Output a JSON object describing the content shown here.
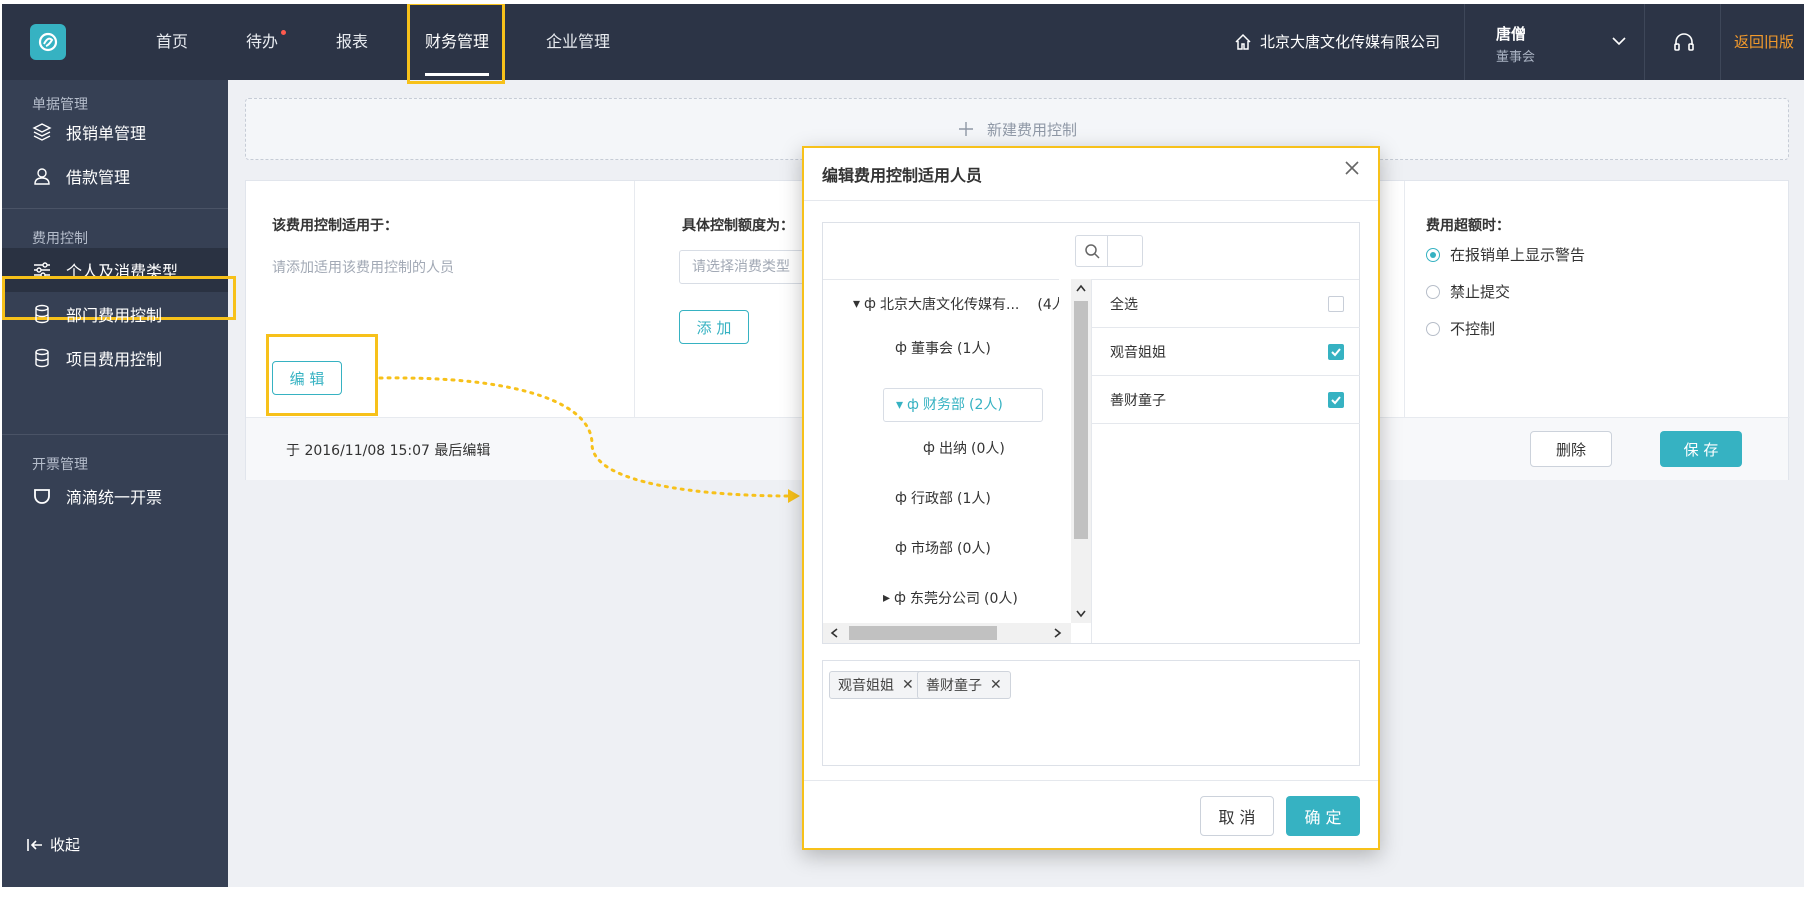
{
  "colors": {
    "accent": "#36b2c2",
    "highlight": "#f7c11a",
    "topbar": "#2c3446",
    "sidebar": "#364054",
    "legacy_link": "#f39a2b"
  },
  "topbar": {
    "nav": [
      {
        "label": "首页",
        "icon": ""
      },
      {
        "label": "待办",
        "badge_dot": true
      },
      {
        "label": "报表"
      },
      {
        "label": "财务管理",
        "active": true
      },
      {
        "label": "企业管理"
      }
    ],
    "company": "北京大唐文化传媒有限公司",
    "user_name": "唐僧",
    "user_role": "董事会",
    "back_old": "返回旧版"
  },
  "sidebar": {
    "groups": [
      {
        "title": "单据管理",
        "items": [
          {
            "label": "报销单管理",
            "icon": "layers-icon"
          },
          {
            "label": "借款管理",
            "icon": "user-icon"
          }
        ]
      },
      {
        "title": "费用控制",
        "items": [
          {
            "label": "个人及消费类型",
            "icon": "sliders-icon",
            "active": true
          },
          {
            "label": "部门费用控制",
            "icon": "database-icon"
          },
          {
            "label": "项目费用控制",
            "icon": "database-icon"
          }
        ]
      },
      {
        "title": "开票管理",
        "items": [
          {
            "label": "滴滴统一开票",
            "icon": "cup-icon"
          }
        ]
      }
    ],
    "collapse": "收起"
  },
  "main": {
    "new_control": "新建费用控制",
    "col1": {
      "title": "该费用控制适用于：",
      "hint": "请添加适用该费用控制的人员",
      "edit": "编 辑"
    },
    "col2": {
      "title": "具体控制额度为：",
      "placeholder": "请选择消费类型",
      "add": "添 加"
    },
    "col3": {
      "title": "费用超额时：",
      "options": [
        {
          "label": "在报销单上显示警告",
          "checked": true
        },
        {
          "label": "禁止提交",
          "checked": false
        },
        {
          "label": "不控制",
          "checked": false
        }
      ]
    },
    "footer": {
      "last_edit": "于 2016/11/08 15:07 最后编辑",
      "delete": "删除",
      "save": "保 存"
    }
  },
  "modal": {
    "title": "编辑费用控制适用人员",
    "tree": [
      {
        "label": "北京大唐文化传媒有...",
        "count": "(4人",
        "expanded": true
      },
      {
        "label": "董事会",
        "count": "(1人)"
      },
      {
        "label": "财务部",
        "count": "(2人)",
        "expanded": true,
        "selected": true
      },
      {
        "label": "出纳",
        "count": "(0人)"
      },
      {
        "label": "行政部",
        "count": "(1人)"
      },
      {
        "label": "市场部",
        "count": "(0人)"
      },
      {
        "label": "东莞分公司",
        "count": "(0人)",
        "collapsed": true
      }
    ],
    "members": [
      {
        "label": "全选",
        "checked": false
      },
      {
        "label": "观音姐姐",
        "checked": true
      },
      {
        "label": "善财童子",
        "checked": true
      }
    ],
    "selected_tags": [
      "观音姐姐",
      "善财童子"
    ],
    "cancel": "取 消",
    "ok": "确 定"
  }
}
